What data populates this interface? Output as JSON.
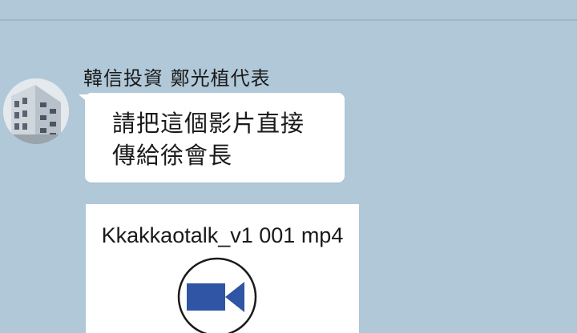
{
  "chat": {
    "sender_name": "韓信投資 鄭光植代表",
    "message_line1": "請把這個影片直接",
    "message_line2": "傳給徐會長",
    "attachment": {
      "file_name": "Kkakkaotalk_v1 001 mp4",
      "icon": "video-camera-icon"
    }
  },
  "colors": {
    "background": "#b0c8d8",
    "bubble": "#ffffff",
    "video_icon": "#2f55a4"
  }
}
